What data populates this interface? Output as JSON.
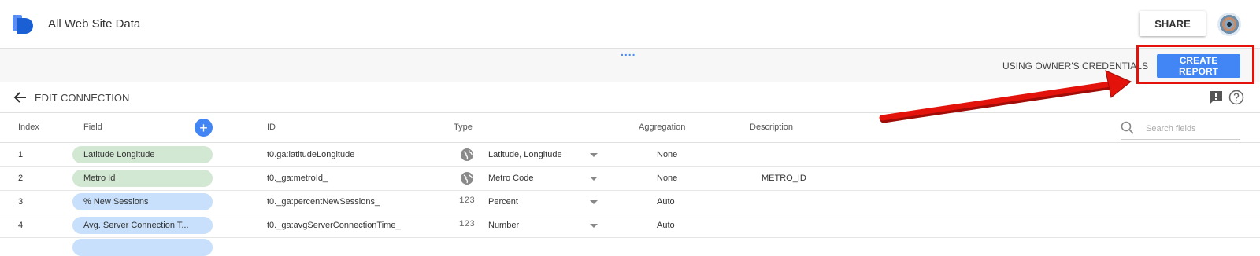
{
  "app": {
    "title": "All Web Site Data",
    "share_label": "SHARE"
  },
  "toolbar": {
    "dots": "....",
    "credentials_label": "USING OWNER'S CREDENTIALS",
    "create_report_label": "CREATE REPORT"
  },
  "edit_connection": {
    "label": "EDIT CONNECTION"
  },
  "table": {
    "headers": {
      "index": "Index",
      "field": "Field",
      "add": "+",
      "id": "ID",
      "type": "Type",
      "aggregation": "Aggregation",
      "description": "Description"
    },
    "search": {
      "placeholder": "Search fields"
    },
    "rows": [
      {
        "index": "1",
        "field": "Latitude Longitude",
        "kind": "dimension",
        "id": "t0.ga:latitudeLongitude",
        "type_icon": "globe-icon",
        "type": "Latitude, Longitude",
        "aggregation": "None",
        "description": ""
      },
      {
        "index": "2",
        "field": "Metro Id",
        "kind": "dimension",
        "id": "t0._ga:metroId_",
        "type_icon": "globe-icon",
        "type": "Metro Code",
        "aggregation": "None",
        "description": "METRO_ID"
      },
      {
        "index": "3",
        "field": "% New Sessions",
        "kind": "metric",
        "id": "t0._ga:percentNewSessions_",
        "type_icon": "number-icon",
        "type_glyph": "123",
        "type": "Percent",
        "aggregation": "Auto",
        "description": ""
      },
      {
        "index": "4",
        "field": "Avg. Server Connection T...",
        "kind": "metric",
        "id": "t0._ga:avgServerConnectionTime_",
        "type_icon": "number-icon",
        "type_glyph": "123",
        "type": "Number",
        "aggregation": "Auto",
        "description": ""
      }
    ]
  },
  "colors": {
    "accent": "#4285f4",
    "dimension_pill": "#d3e8d3",
    "metric_pill": "#c8e0fb",
    "highlight": "#e3120b"
  }
}
